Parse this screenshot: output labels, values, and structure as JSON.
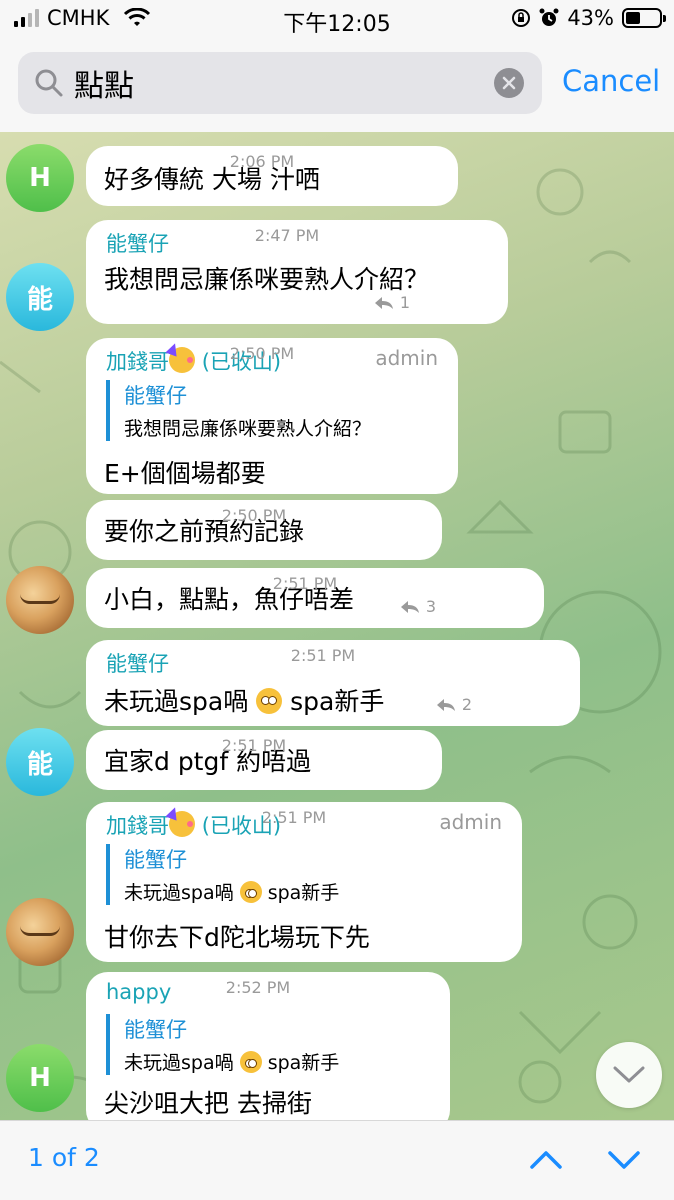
{
  "status_bar": {
    "carrier": "CMHK",
    "time": "下午12:05",
    "battery": "43%",
    "battery_level": 0.43
  },
  "search": {
    "query": "點點",
    "cancel_label": "Cancel"
  },
  "messages": [
    {
      "avatar_letter": "H",
      "text": "好多傳統 大場 汁哂",
      "time": "2:06 PM"
    },
    {
      "avatar_letter": "能",
      "sender": "能蟹仔",
      "text": "我想問忌廉係咪要熟人介紹？",
      "replies": "1",
      "time": "2:47 PM"
    },
    {
      "sender": "加錢哥",
      "sender_suffix": "(已收山)",
      "role": "admin",
      "quote_name": "能蟹仔",
      "quote_text": "我想問忌廉係咪要熟人介紹？",
      "text": "E+個個場都要",
      "time": "2:50 PM"
    },
    {
      "text": "要你之前預約記錄",
      "time": "2:50 PM"
    },
    {
      "text": "小白，點點，魚仔唔差",
      "replies": "3",
      "time": "2:51 PM"
    },
    {
      "sender": "能蟹仔",
      "text_a": "未玩過spa喎",
      "text_b": "spa新手",
      "replies": "2",
      "time": "2:51 PM"
    },
    {
      "avatar_letter": "能",
      "text": "宜家d ptgf 約唔過",
      "time": "2:51 PM"
    },
    {
      "sender": "加錢哥",
      "sender_suffix": "(已收山)",
      "role": "admin",
      "quote_name": "能蟹仔",
      "quote_text_a": "未玩過spa喎",
      "quote_text_b": "spa新手",
      "text": "甘你去下d陀北場玩下先",
      "time": "2:51 PM"
    },
    {
      "avatar_letter": "H",
      "sender": "happy",
      "quote_name": "能蟹仔",
      "quote_text_a": "未玩過spa喎",
      "quote_text_b": "spa新手",
      "text": "尖沙咀大把 去掃街",
      "time": "2:52 PM"
    }
  ],
  "bottom": {
    "counter": "1 of 2"
  },
  "colors": {
    "accent": "#1a8cff",
    "sender_teal": "#1aa3b5",
    "quote_blue": "#1e90d6"
  }
}
